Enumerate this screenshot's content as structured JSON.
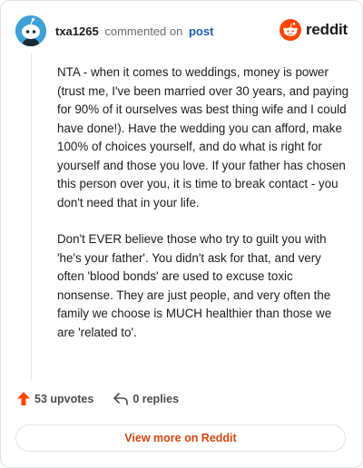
{
  "header": {
    "username": "txa1265",
    "action_text": "commented on",
    "post_link": "post"
  },
  "brand": {
    "wordmark": "reddit",
    "icon": "reddit-logo-icon",
    "color": "#ff4500"
  },
  "comment": {
    "paragraphs": [
      "NTA - when it comes to weddings, money is power (trust me, I've been married over 30 years, and paying for 90% of it ourselves was best thing wife and I could have done!). Have the wedding you can afford, make 100% of choices yourself, and do what is right for yourself and those you love. If your father has chosen this person over you, it is time to break contact - you don't need that in your life.",
      "Don't EVER believe those who try to guilt you with 'he's your father'. You didn't ask for that, and very often 'blood bonds' are used to excuse toxic nonsense. They are just people, and very often the family we choose is MUCH healthier than those we are 'related to'."
    ]
  },
  "actions": {
    "upvotes": "53 upvotes",
    "upvote_icon": "upvote-arrow-icon",
    "upvote_color": "#ff4500",
    "replies": "0 replies",
    "reply_icon": "reply-arrow-icon"
  },
  "footer": {
    "view_more": "View more on Reddit",
    "link_color": "#d2460f"
  }
}
